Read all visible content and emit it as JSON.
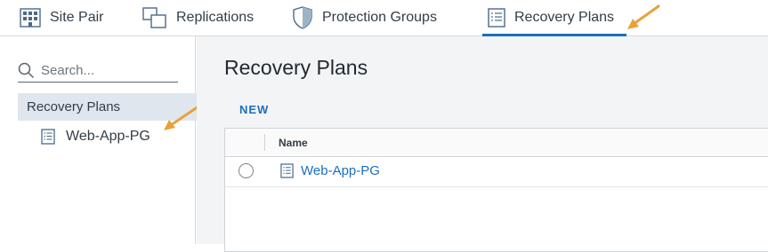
{
  "tabs": [
    {
      "label": "Site Pair",
      "icon": "building-icon"
    },
    {
      "label": "Replications",
      "icon": "replication-icon"
    },
    {
      "label": "Protection Groups",
      "icon": "shield-icon"
    },
    {
      "label": "Recovery Plans",
      "icon": "recovery-plan-icon",
      "active": true
    }
  ],
  "sidebar": {
    "search_placeholder": "Search...",
    "root_label": "Recovery Plans",
    "child_label": "Web-App-PG"
  },
  "main": {
    "title": "Recovery Plans",
    "new_label": "NEW",
    "grid": {
      "columns": [
        "Name"
      ],
      "rows": [
        {
          "name": "Web-App-PG",
          "selected": false
        }
      ]
    }
  },
  "colors": {
    "accent": "#1b6fbf",
    "annotation_arrow": "#e8a23a",
    "sidebar_selected": "#dfe6ed"
  }
}
